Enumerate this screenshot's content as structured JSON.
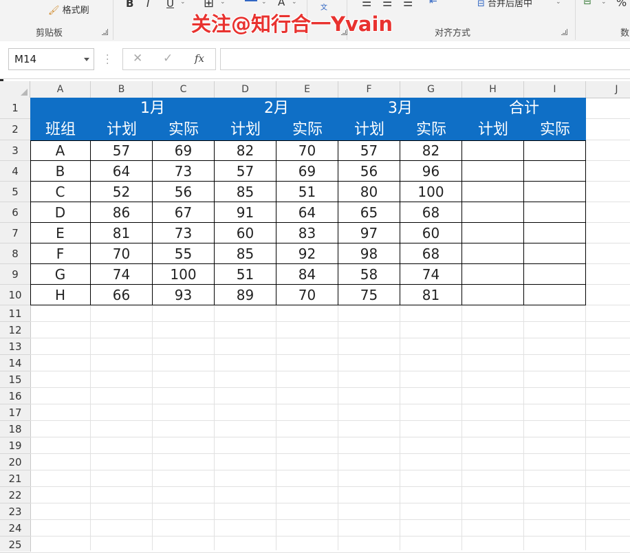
{
  "ribbon": {
    "format_painter": "格式刷",
    "bold": "B",
    "italic": "I",
    "underline": "U",
    "font_color": "A",
    "merge_center": "合并后居中",
    "percent": "%",
    "groups": {
      "clipboard": "剪贴板",
      "alignment": "对齐方式",
      "number": "数"
    }
  },
  "overlay_title": "关注@知行合一Yvain",
  "formula_bar": {
    "name_box": "M14",
    "fx": "fx",
    "formula": ""
  },
  "columns": [
    "A",
    "B",
    "C",
    "D",
    "E",
    "F",
    "G",
    "H",
    "I",
    "J"
  ],
  "rows": [
    "1",
    "2",
    "3",
    "4",
    "5",
    "6",
    "7",
    "8",
    "9",
    "10",
    "11",
    "12",
    "13",
    "14",
    "15",
    "16",
    "17",
    "18",
    "19",
    "20",
    "21",
    "22",
    "23",
    "24",
    "25"
  ],
  "table": {
    "months": [
      "1月",
      "2月",
      "3月",
      "合计"
    ],
    "group_label": "班组",
    "sub_headers": [
      "计划",
      "实际",
      "计划",
      "实际",
      "计划",
      "实际",
      "计划",
      "实际"
    ],
    "data": [
      [
        "A",
        "57",
        "69",
        "82",
        "70",
        "57",
        "82",
        "",
        ""
      ],
      [
        "B",
        "64",
        "73",
        "57",
        "69",
        "56",
        "96",
        "",
        ""
      ],
      [
        "C",
        "52",
        "56",
        "85",
        "51",
        "80",
        "100",
        "",
        ""
      ],
      [
        "D",
        "86",
        "67",
        "91",
        "64",
        "65",
        "68",
        "",
        ""
      ],
      [
        "E",
        "81",
        "73",
        "60",
        "83",
        "97",
        "60",
        "",
        ""
      ],
      [
        "F",
        "70",
        "55",
        "85",
        "92",
        "98",
        "68",
        "",
        ""
      ],
      [
        "G",
        "74",
        "100",
        "51",
        "84",
        "58",
        "74",
        "",
        ""
      ],
      [
        "H",
        "66",
        "93",
        "89",
        "70",
        "75",
        "81",
        "",
        ""
      ]
    ]
  },
  "colors": {
    "header_fill": "#0f6fc6",
    "header_text": "#ffffff",
    "overlay_text": "#e8322f"
  }
}
